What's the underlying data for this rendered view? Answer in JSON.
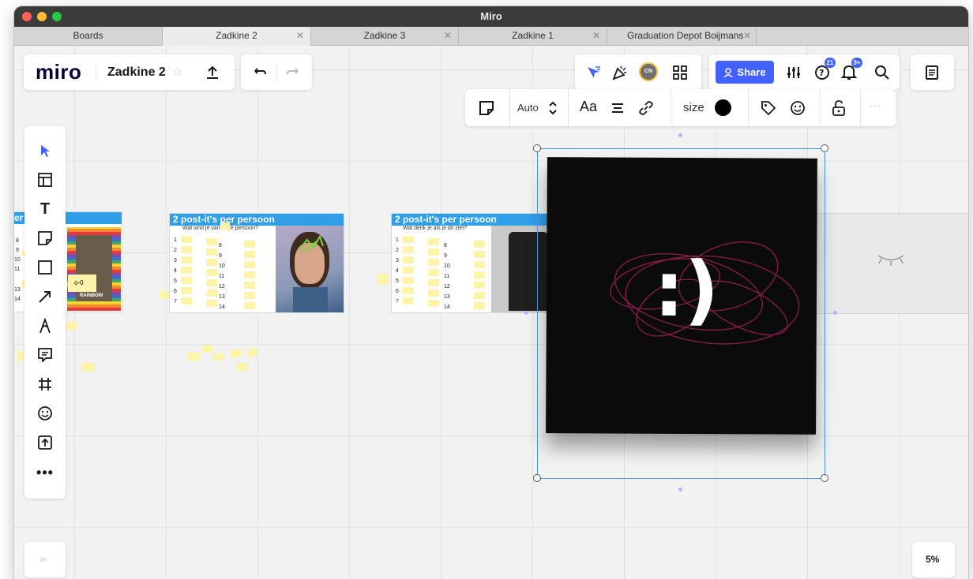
{
  "window": {
    "title": "Miro"
  },
  "tabs": [
    {
      "label": "Boards",
      "closable": false,
      "active": false
    },
    {
      "label": "Zadkine 2",
      "closable": true,
      "active": true
    },
    {
      "label": "Zadkine 3",
      "closable": true,
      "active": false
    },
    {
      "label": "Zadkine 1",
      "closable": true,
      "active": false
    },
    {
      "label": "Graduation Depot Boijmans",
      "closable": true,
      "active": false
    }
  ],
  "toolbar": {
    "logo": "miro",
    "board_name": "Zadkine 2",
    "share_label": "Share",
    "avatar_initials": "CN",
    "help_badge": "21",
    "notifications_badge": "9+"
  },
  "context_toolbar": {
    "autosize_label": "Auto",
    "text_label": "Aa",
    "size_label": "size",
    "more_label": "···"
  },
  "left_tools": [
    "select-icon",
    "templates-icon",
    "text-icon",
    "sticky-note-icon",
    "shape-icon",
    "arrow-icon",
    "pen-icon",
    "comment-icon",
    "frame-icon",
    "emoji-icon",
    "upload-icon",
    "more-icon"
  ],
  "frames": {
    "frame1": {
      "title": "2 post-it's per persoon",
      "subtitle": "Wat vind je van deze persoon?",
      "left_numbers": [
        "1",
        "2",
        "3",
        "4",
        "5",
        "6",
        "7"
      ],
      "right_numbers": [
        "8",
        "9",
        "10",
        "11",
        "12",
        "13",
        "14"
      ]
    },
    "frame2": {
      "title": "2 post-it's per persoon",
      "subtitle": "Wat denk je als je dit ziet?",
      "left_numbers": [
        "1",
        "2",
        "3",
        "4",
        "5",
        "6",
        "7"
      ],
      "right_numbers": [
        "8",
        "9",
        "10",
        "11",
        "12",
        "13",
        "14"
      ]
    },
    "partial_frame": {
      "title": "er",
      "left_numbers": [
        "8",
        "9",
        "10",
        "11",
        "13",
        "14"
      ],
      "sticky_text": "o-0",
      "image_caption": "RAINBOW"
    }
  },
  "selected_image": {
    "content": ":)"
  },
  "bottom": {
    "expand_label": "››",
    "zoom": "5%"
  }
}
